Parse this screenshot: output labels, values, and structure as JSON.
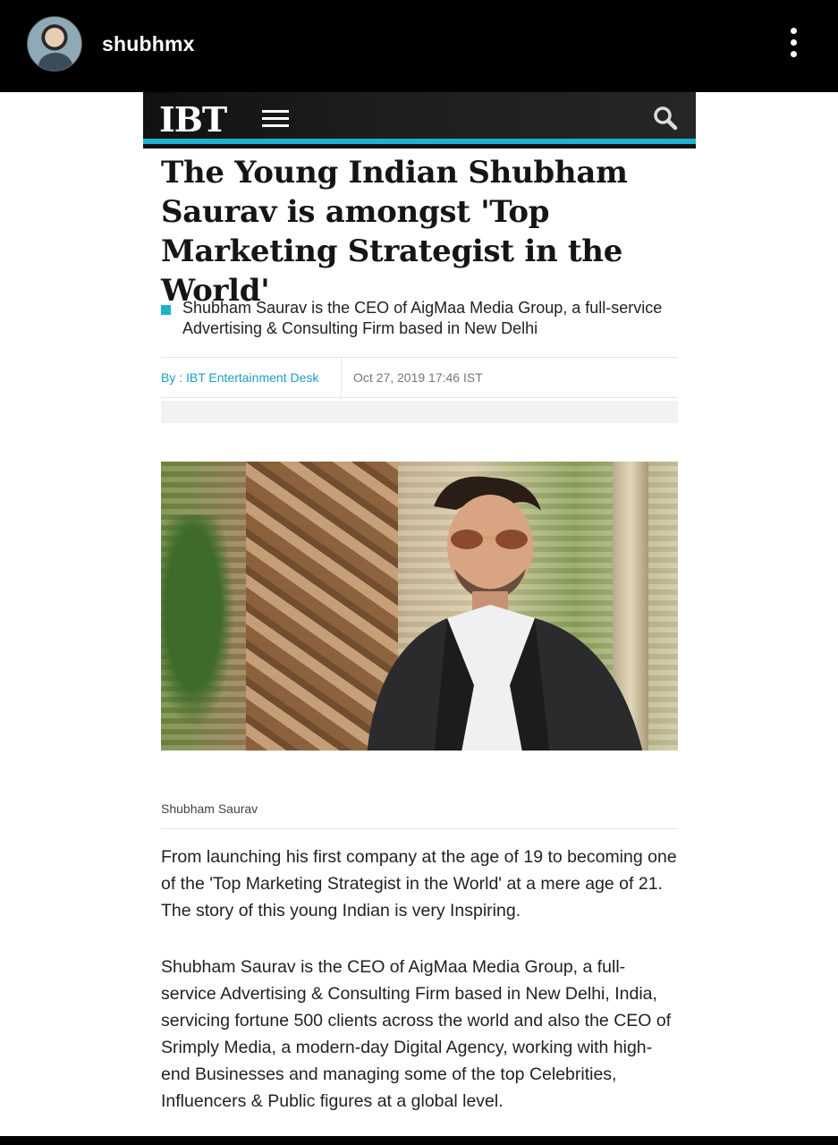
{
  "post_header": {
    "username": "shubhmx",
    "avatar_icon": "profile-avatar",
    "more_icon": "vertical-ellipsis-icon"
  },
  "site": {
    "logo_text": "IBT",
    "accent_color": "#1cb3d0"
  },
  "article": {
    "headline": "The Young Indian Shubham Saurav is amongst 'Top Marketing Strategist in the World'",
    "summary": "Shubham Saurav is the CEO of AigMaa Media Group, a full-service Advertising & Consulting Firm based in New Delhi",
    "byline": "By : IBT Entertainment Desk",
    "date": "Oct 27, 2019 17:46 IST",
    "image_caption": "Shubham Saurav",
    "paragraphs": [
      "From launching his first company at the age of 19 to becoming one of the 'Top Marketing Strategist in the World' at a mere age of 21. The story of this young Indian is very Inspiring.",
      "Shubham Saurav is the CEO of AigMaa Media Group, a full-service Advertising & Consulting Firm based in New Delhi, India, servicing fortune 500 clients across the world and also the CEO of Srimply Media, a modern-day Digital Agency, working with high-end Businesses and managing some of the top Celebrities, Influencers & Public figures at a global level."
    ]
  }
}
